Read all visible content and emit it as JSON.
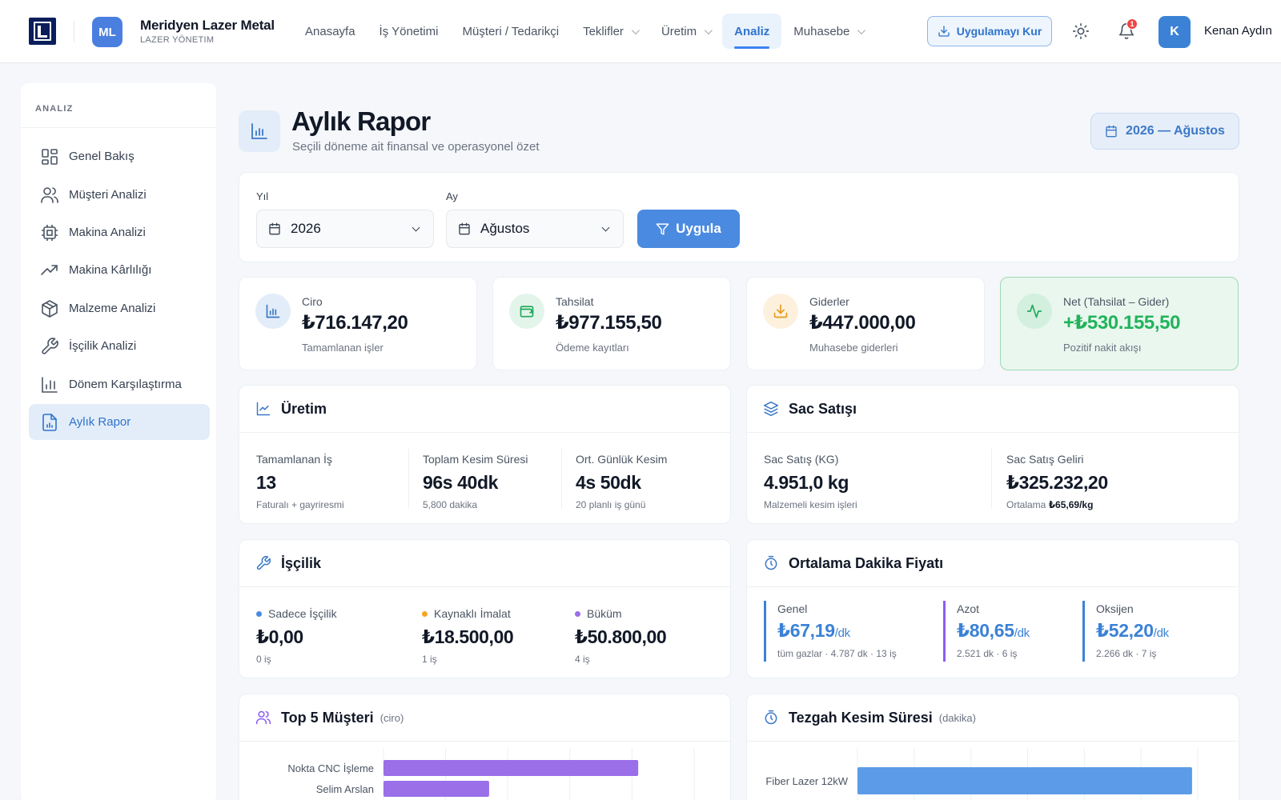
{
  "header": {
    "brand_initials": "ML",
    "brand_name": "Meridyen Lazer Metal",
    "brand_sub": "LAZER YÖNETIM",
    "nav": [
      {
        "label": "Anasayfa"
      },
      {
        "label": "İş Yönetimi"
      },
      {
        "label": "Müşteri / Tedarikçi"
      },
      {
        "label": "Teklifler",
        "dropdown": true
      },
      {
        "label": "Üretim",
        "dropdown": true
      },
      {
        "label": "Analiz",
        "active": true
      },
      {
        "label": "Muhasebe",
        "dropdown": true
      }
    ],
    "install_label": "Uygulamayı Kur",
    "notification_count": "1",
    "user_initial": "K",
    "user_name": "Kenan Aydın"
  },
  "sidebar": {
    "heading": "ANALIZ",
    "items": [
      {
        "label": "Genel Bakış",
        "icon": "grid-icon"
      },
      {
        "label": "Müşteri Analizi",
        "icon": "users-icon"
      },
      {
        "label": "Makina Analizi",
        "icon": "cpu-icon"
      },
      {
        "label": "Makina Kârlılığı",
        "icon": "trend-up-icon"
      },
      {
        "label": "Malzeme Analizi",
        "icon": "box-icon"
      },
      {
        "label": "İşçilik Analizi",
        "icon": "wrench-icon"
      },
      {
        "label": "Dönem Karşılaştırma",
        "icon": "bar-chart-icon"
      },
      {
        "label": "Aylık Rapor",
        "icon": "report-icon",
        "active": true
      }
    ]
  },
  "page": {
    "title": "Aylık Rapor",
    "subtitle": "Seçili döneme ait finansal ve operasyonel özet",
    "period_label": "2026 — Ağustos"
  },
  "filters": {
    "year_label": "Yıl",
    "year_value": "2026",
    "month_label": "Ay",
    "month_value": "Ağustos",
    "apply_label": "Uygula"
  },
  "kpis": {
    "ciro": {
      "label": "Ciro",
      "value": "₺716.147,20",
      "note": "Tamamlanan işler"
    },
    "tahsilat": {
      "label": "Tahsilat",
      "value": "₺977.155,50",
      "note": "Ödeme kayıtları"
    },
    "giderler": {
      "label": "Giderler",
      "value": "₺447.000,00",
      "note": "Muhasebe giderleri"
    },
    "net": {
      "label": "Net (Tahsilat – Gider)",
      "value": "+₺530.155,50",
      "note": "Pozitif nakit akışı"
    }
  },
  "uretim": {
    "title": "Üretim",
    "stats": [
      {
        "label": "Tamamlanan İş",
        "value": "13",
        "note": "Faturalı + gayriresmi"
      },
      {
        "label": "Toplam Kesim Süresi",
        "value": "96s 40dk",
        "note": "5,800 dakika"
      },
      {
        "label": "Ort. Günlük Kesim",
        "value": "4s 50dk",
        "note": "20 planlı iş günü"
      }
    ]
  },
  "sac": {
    "title": "Sac Satışı",
    "kg_label": "Sac Satış (KG)",
    "kg_value": "4.951,0 kg",
    "kg_note": "Malzemeli kesim işleri",
    "rev_label": "Sac Satış Geliri",
    "rev_value": "₺325.232,20",
    "rev_note_prefix": "Ortalama",
    "rev_note_value": "₺65,69/kg"
  },
  "iscilik": {
    "title": "İşçilik",
    "stats": [
      {
        "label": "Sadece İşçilik",
        "value": "₺0,00",
        "note": "0 iş",
        "color": "#4a8ae0"
      },
      {
        "label": "Kaynaklı İmalat",
        "value": "₺18.500,00",
        "note": "1 iş",
        "color": "#f5a524"
      },
      {
        "label": "Büküm",
        "value": "₺50.800,00",
        "note": "4 iş",
        "color": "#9a6fe8"
      }
    ]
  },
  "dakika": {
    "title": "Ortalama Dakika Fiyatı",
    "unit": "/dk",
    "items": [
      {
        "label": "Genel",
        "value": "₺67,19",
        "note": "tüm gazlar · 4.787 dk · 13 iş",
        "color": "#3b82d6"
      },
      {
        "label": "Azot",
        "value": "₺80,65",
        "note": "2.521 dk · 6 iş",
        "color": "#8b5cf6"
      },
      {
        "label": "Oksijen",
        "value": "₺52,20",
        "note": "2.266 dk · 7 iş",
        "color": "#3b82d6"
      }
    ]
  },
  "top5": {
    "title": "Top 5 Müşteri",
    "unit": "(ciro)",
    "color": "#9a6fe8"
  },
  "tezgah": {
    "title": "Tezgah Kesim Süresi",
    "unit": "(dakika)",
    "color": "#5b9be8"
  },
  "chart_data": [
    {
      "type": "bar",
      "orientation": "horizontal",
      "categories": [
        "Nokta CNC İşleme",
        "Selim Arslan"
      ],
      "values": [
        205000,
        85000
      ],
      "xlim": [
        0,
        250000
      ],
      "grid": true
    },
    {
      "type": "bar",
      "orientation": "horizontal",
      "categories": [
        "Fiber Lazer 12kW"
      ],
      "values": [
        2950
      ],
      "xlim": [
        0,
        3000
      ],
      "grid": true
    }
  ]
}
